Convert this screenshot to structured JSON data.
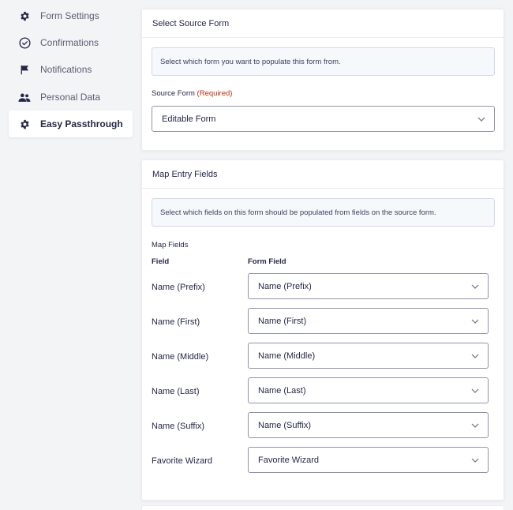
{
  "sidebar": {
    "items": [
      {
        "label": "Form Settings",
        "icon": "gear-icon"
      },
      {
        "label": "Confirmations",
        "icon": "check-circle-icon"
      },
      {
        "label": "Notifications",
        "icon": "flag-icon"
      },
      {
        "label": "Personal Data",
        "icon": "users-icon"
      },
      {
        "label": "Easy Passthrough",
        "icon": "gear-icon",
        "active": true
      }
    ]
  },
  "source_panel": {
    "title": "Select Source Form",
    "notice": "Select which form you want to populate this form from.",
    "source_label": "Source Form",
    "required_label": "(Required)",
    "source_value": "Editable Form"
  },
  "map_panel": {
    "title": "Map Entry Fields",
    "notice": "Select which fields on this form should be populated from fields on the source form.",
    "map_fields_label": "Map Fields",
    "col_field": "Field",
    "col_form_field": "Form Field",
    "rows": [
      {
        "field": "Name (Prefix)",
        "value": "Name (Prefix)"
      },
      {
        "field": "Name (First)",
        "value": "Name (First)"
      },
      {
        "field": "Name (Middle)",
        "value": "Name (Middle)"
      },
      {
        "field": "Name (Last)",
        "value": "Name (Last)"
      },
      {
        "field": "Name (Suffix)",
        "value": "Name (Suffix)"
      },
      {
        "field": "Favorite Wizard",
        "value": "Favorite Wizard"
      }
    ]
  },
  "colors": {
    "background": "#f3f4f6",
    "text": "#242748",
    "required": "#c02b0a",
    "border": "#9092b2"
  }
}
